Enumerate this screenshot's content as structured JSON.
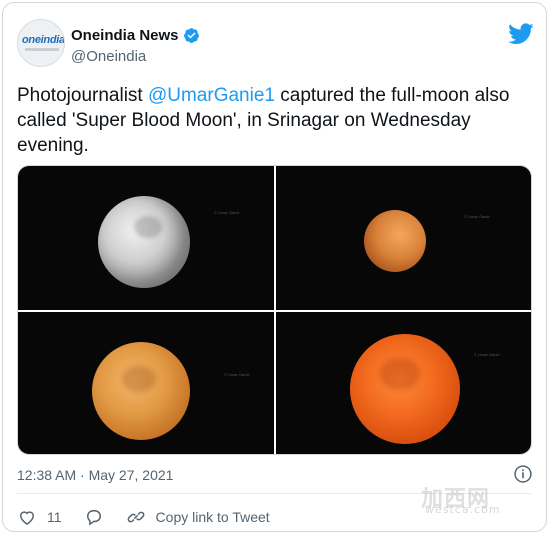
{
  "tweet": {
    "author_name": "Oneindia News",
    "handle": "@Oneindia",
    "avatar_logo_text": "oneindia",
    "text_before": "Photojournalist ",
    "mention": "@UmarGanie1",
    "text_after": " captured the full-moon also called 'Super Blood Moon', in Srinagar on Wednesday evening.",
    "timestamp": "12:38 AM · May 27, 2021",
    "likes": "11",
    "copy_link_label": "Copy link to Tweet"
  },
  "photos": {
    "credit": "© Umar Ganie"
  },
  "watermark": {
    "main": "加西网",
    "url": "westca.com"
  },
  "colors": {
    "link": "#1d9bf0",
    "twitter_blue": "#1d9bf0",
    "text": "#0f1419",
    "muted": "#536471"
  }
}
